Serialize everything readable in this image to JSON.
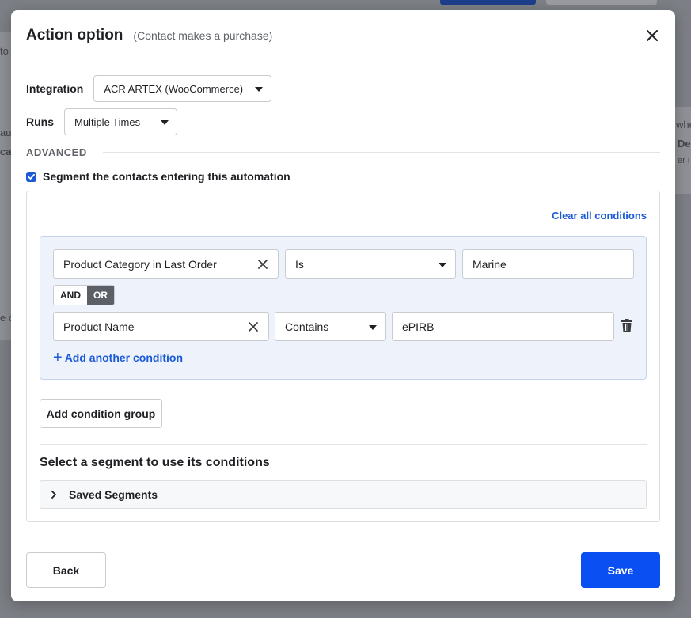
{
  "background": {
    "fragments": [
      "to",
      "au",
      "ca",
      "e c",
      "whe",
      "De",
      "er i"
    ]
  },
  "modal": {
    "title": "Action option",
    "subtitle": "(Contact makes a purchase)",
    "close_icon": "close-icon"
  },
  "integration": {
    "label": "Integration",
    "value": "ACR ARTEX (WooCommerce)"
  },
  "runs": {
    "label": "Runs",
    "value": "Multiple Times"
  },
  "advanced": {
    "label": "ADVANCED"
  },
  "segment_checkbox": {
    "label": "Segment the contacts entering this automation",
    "checked": true
  },
  "conditions": {
    "clear_all": "Clear all conditions",
    "rows": [
      {
        "field": "Product Category in Last Order",
        "operator": "Is",
        "value": "Marine"
      },
      {
        "field": "Product Name",
        "operator": "Contains",
        "value": "ePIRB"
      }
    ],
    "and_label": "AND",
    "or_label": "OR",
    "selected_logic": "OR",
    "add_condition": "Add another condition",
    "add_group": "Add condition group"
  },
  "saved_segments": {
    "title": "Select a segment to use its conditions",
    "label": "Saved Segments"
  },
  "footer": {
    "back": "Back",
    "save": "Save"
  },
  "colors": {
    "accent": "#0a4ff2",
    "link": "#1a5ad7",
    "group_bg": "#eef2fb"
  }
}
